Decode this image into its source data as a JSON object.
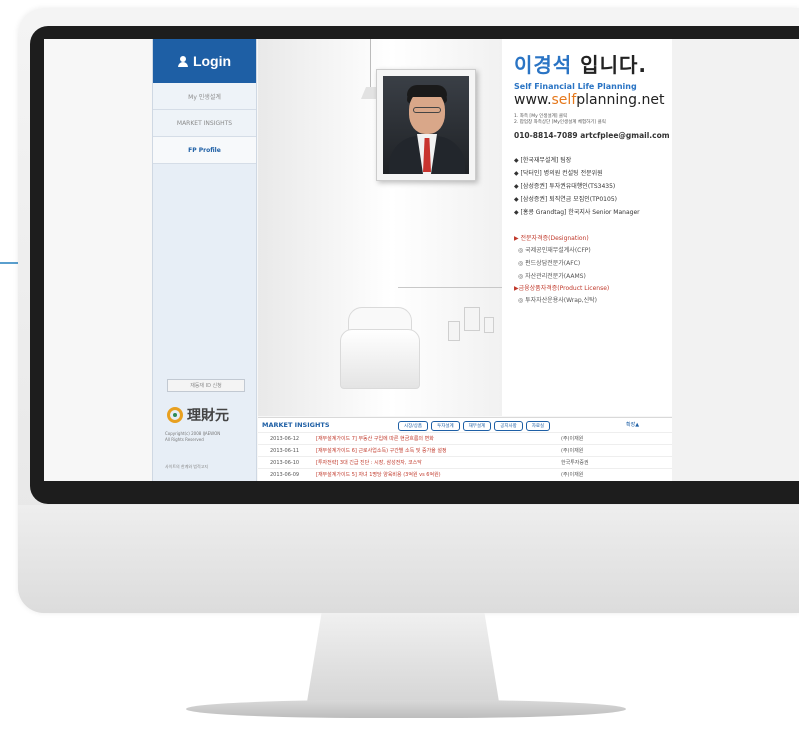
{
  "sidebar": {
    "login_label": "Login",
    "menu": [
      "My 인생설계",
      "MARKET INSIGHTS",
      "FP Profile"
    ],
    "id_button": "재등재 ID 신청",
    "logo_text": "理財元",
    "copyright_line1": "Copyright(c) 2008 IJAEWON",
    "copyright_line2": "All Rights Reserved",
    "footer": "사이트의 한계와 법적고지"
  },
  "profile": {
    "name": "이경석",
    "name_suffix": " 입니다.",
    "subtitle": "Self Financial Life Planning",
    "url_prefix": "www.",
    "url_highlight": "self",
    "url_suffix": "planning.net",
    "note1": "1. 좌측 [My 인생설계] 클릭",
    "note2": "2. 팝업창 좌측상단 [My인생설계 체험하기] 클릭",
    "contact": "010-8814-7089 artcfplee@gmail.com",
    "roles": [
      "◆ [한국재무설계] 팀장",
      "◆ [닥터인] 병의원 컨설팅 전문위원",
      "◆ [삼성증권] 투자권유대행인(TS3435)",
      "◆ [삼성증권] 퇴직연금 모집인(TP0105)",
      "◆ [홍콩 Grandtag] 한국지사 Senior Manager"
    ],
    "designation_title": "▶ 전문자격증(Designation)",
    "designations": [
      "◎ 국제공인재무설계사(CFP)",
      "◎ 펀드상담전문가(AFC)",
      "◎ 자산관리전문가(AAMS)"
    ],
    "license_title": "▶금융상품자격증(Product License)",
    "licenses": [
      "◎ 투자자산운용사(Wrap,신탁)"
    ]
  },
  "insights": {
    "title": "MARKET INSIGHTS",
    "tabs": [
      "시장/상품",
      "투자설계",
      "재무설계",
      "공지사항",
      "자료실"
    ],
    "more": "확장▲",
    "rows": [
      {
        "date": "2013-06-12",
        "subject": "[재무설계가이드 7] 부동산 구입에 따른 현금흐름의 변화",
        "source": "(주)이재원"
      },
      {
        "date": "2013-06-11",
        "subject": "[재무설계가이드 6] 근로사업소득) 구간별 소득 및 증가율 설정",
        "source": "(주)이재원"
      },
      {
        "date": "2013-06-10",
        "subject": "[투자전략] 3대 긴급 진단 : 시장, 삼성전자, 코스닥",
        "source": "한국투자증권"
      },
      {
        "date": "2013-06-09",
        "subject": "[재무설계가이드 5] 자녀 1명당 양육비용 (3억원 vs 6억원)",
        "source": "(주)이재원"
      }
    ]
  }
}
